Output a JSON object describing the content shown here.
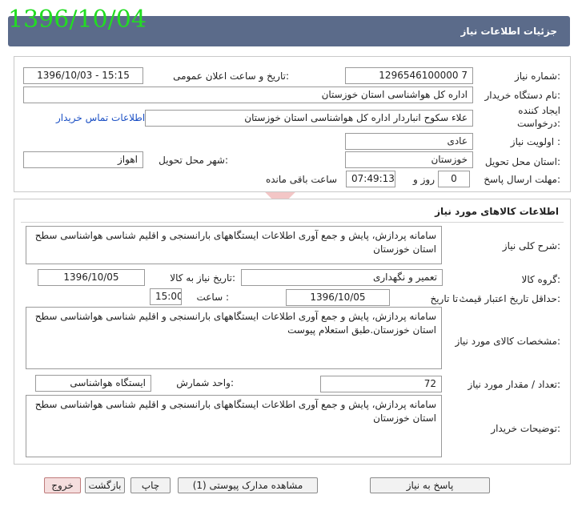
{
  "stamp_date": "1396/10/04",
  "header": {
    "title": "جزئیات اطلاعات نیاز"
  },
  "info": {
    "need_number_label": "شماره نیاز:",
    "need_number": "1296546100000 7",
    "announce_label": "تاریخ و ساعت اعلان عمومی:",
    "announce_value": "1396/10/03 - 15:15",
    "buyer_org_label": "نام دستگاه خریدار:",
    "buyer_org": "اداره کل هواشناسی استان خوزستان",
    "creator_label_1": "ایجاد کننده",
    "creator_label_2": "درخواست:",
    "creator": "علاء سکوح انباردار اداره کل هواشناسی استان خوزستان",
    "contact_link": "اطلاعات تماس خریدار",
    "priority_label": "اولویت نیاز :",
    "priority": "عادی",
    "province_label": "استان محل تحویل:",
    "province": "خوزستان",
    "city_label": "شهر محل تحویل:",
    "city": "اهواز",
    "deadline_label": "مهلت ارسال پاسخ:",
    "days": "0",
    "days_label": "روز و",
    "time": "07:49:13",
    "remaining_label": "ساعت باقی مانده"
  },
  "goods": {
    "section_title": "اطلاعات کالاهای مورد نیاز",
    "general_desc_label": "شرح کلی نیاز:",
    "general_desc": "سامانه پردازش، پایش و جمع آوری اطلاعات ایستگاههای بارانسنجی و اقلیم شناسی هواشناسی سطح استان خوزستان",
    "group_label": "گروه کالا:",
    "group": "تعمیر و نگهداری",
    "need_date_label": "تاریخ نیاز به کالا:",
    "need_date": "1396/10/05",
    "min_price_label": "حداقل تاریخ اعتبار قیمت:",
    "until_date_label": "تا تاریخ :",
    "until_date": "1396/10/05",
    "hour_label": "ساعت :",
    "hour": "15:00",
    "spec_label": "مشخصات کالای مورد نیاز:",
    "spec": "سامانه پردازش، پایش و جمع آوری اطلاعات ایستگاههای بارانسنجی و اقلیم شناسی هواشناسی سطح استان خوزستان.طبق استعلام پیوست",
    "qty_label": "تعداد / مقدار مورد نیاز:",
    "qty": "72",
    "unit_label": "واحد شمارش:",
    "unit": "ایستگاه هواشناسی",
    "buyer_notes_label": "توضیحات خریدار:",
    "buyer_notes": "سامانه پردازش، پایش و جمع آوری اطلاعات ایستگاههای بارانسنجی و اقلیم شناسی هواشناسی سطح استان خوزستان"
  },
  "buttons": {
    "reply": "پاسخ به نیاز",
    "attachments": "مشاهده مدارک پیوستی (1)",
    "print": "چاپ",
    "back": "بازگشت",
    "exit": "خروج"
  },
  "colors": {
    "title_bar": "#5b6b8a",
    "stamp": "#22dd22",
    "link": "#1a4fc4"
  }
}
